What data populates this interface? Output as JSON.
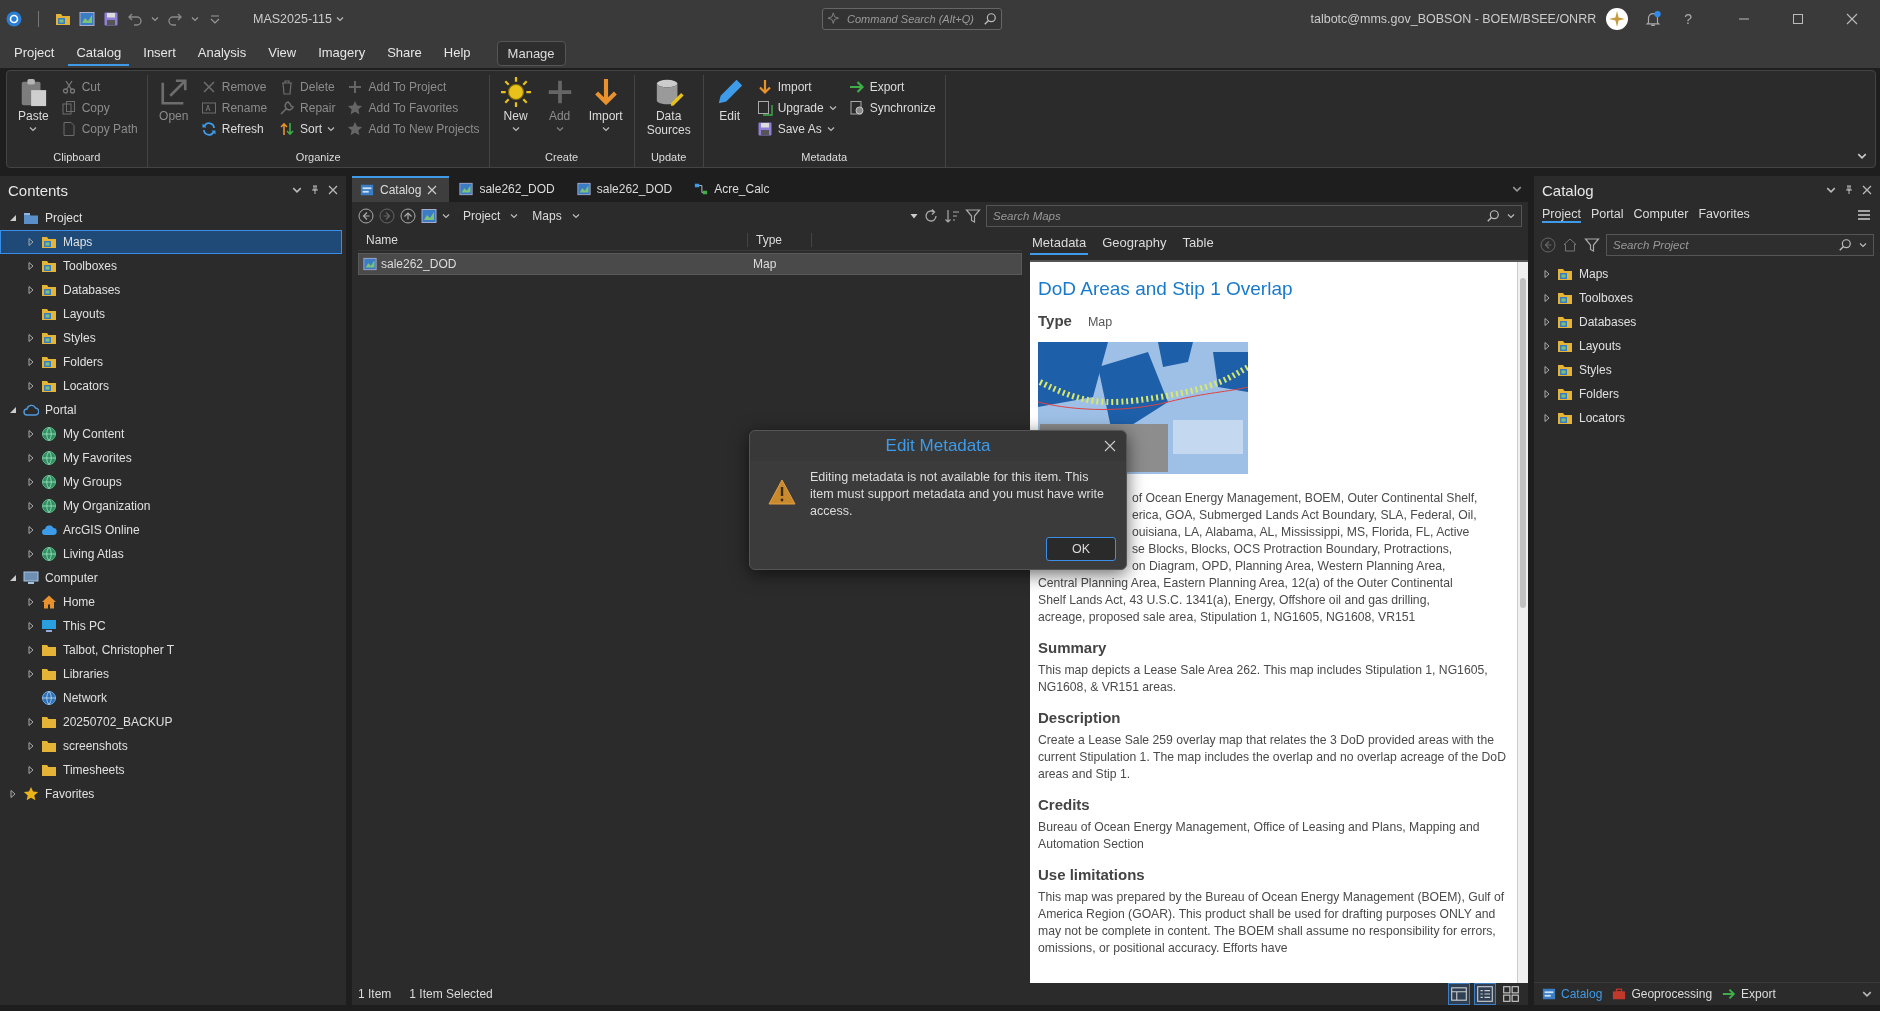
{
  "title_bar": {
    "project_name": "MAS2025-115",
    "command_search": {
      "placeholder": "Command Search (Alt+Q)"
    },
    "user": "talbotc@mms.gov_BOBSON - BOEM/BSEE/ONRR",
    "has_notification": true,
    "help": "?"
  },
  "menu_tabs": [
    {
      "label": "Project",
      "selected": false
    },
    {
      "label": "Catalog",
      "selected": true
    },
    {
      "label": "Insert",
      "selected": false
    },
    {
      "label": "Analysis",
      "selected": false
    },
    {
      "label": "View",
      "selected": false
    },
    {
      "label": "Imagery",
      "selected": false
    },
    {
      "label": "Share",
      "selected": false
    },
    {
      "label": "Help",
      "selected": false
    }
  ],
  "context_tab": "Manage",
  "ribbon": {
    "groups": [
      {
        "label": "Clipboard",
        "items": [
          {
            "label": "Paste",
            "kind": "large",
            "disabled": false,
            "dropdown": true
          },
          {
            "label": "Cut",
            "kind": "small",
            "disabled": true,
            "dropdown": false
          },
          {
            "label": "Copy",
            "kind": "small",
            "disabled": true,
            "dropdown": false
          },
          {
            "label": "Copy Path",
            "kind": "small",
            "disabled": true,
            "dropdown": false
          }
        ]
      },
      {
        "label": "Organize",
        "items": [
          {
            "label": "Open",
            "kind": "large",
            "disabled": true,
            "dropdown": false
          },
          {
            "label": "Remove",
            "kind": "small",
            "disabled": true,
            "dropdown": false
          },
          {
            "label": "Rename",
            "kind": "small",
            "disabled": true,
            "dropdown": false
          },
          {
            "label": "Refresh",
            "kind": "small",
            "disabled": false,
            "dropdown": false
          },
          {
            "label": "Delete",
            "kind": "small",
            "disabled": true,
            "dropdown": false
          },
          {
            "label": "Repair",
            "kind": "small",
            "disabled": true,
            "dropdown": false
          },
          {
            "label": "Sort",
            "kind": "small",
            "disabled": false,
            "dropdown": true
          },
          {
            "label": "Add To Project",
            "kind": "small",
            "disabled": true,
            "dropdown": false
          },
          {
            "label": "Add To Favorites",
            "kind": "small",
            "disabled": true,
            "dropdown": false
          },
          {
            "label": "Add To New Projects",
            "kind": "small",
            "disabled": true,
            "dropdown": false
          }
        ]
      },
      {
        "label": "Create",
        "items": [
          {
            "label": "New",
            "kind": "large",
            "disabled": false,
            "dropdown": true
          },
          {
            "label": "Add",
            "kind": "large",
            "disabled": true,
            "dropdown": true
          },
          {
            "label": "Import",
            "kind": "large",
            "disabled": false,
            "dropdown": true
          }
        ]
      },
      {
        "label": "Update",
        "items": [
          {
            "label": "Data Sources",
            "kind": "large",
            "disabled": false,
            "dropdown": false
          }
        ]
      },
      {
        "label": "Metadata",
        "items": [
          {
            "label": "Edit",
            "kind": "large",
            "disabled": false,
            "dropdown": false
          },
          {
            "label": "Import",
            "kind": "small",
            "disabled": false,
            "dropdown": false
          },
          {
            "label": "Upgrade",
            "kind": "small",
            "disabled": false,
            "dropdown": true
          },
          {
            "label": "Save As",
            "kind": "small",
            "disabled": false,
            "dropdown": true
          },
          {
            "label": "Export",
            "kind": "small",
            "disabled": false,
            "dropdown": false
          },
          {
            "label": "Synchronize",
            "kind": "small",
            "disabled": false,
            "dropdown": false
          }
        ]
      }
    ]
  },
  "contents": {
    "title": "Contents",
    "tree": [
      {
        "label": "Project",
        "kind": "project",
        "expanded": true,
        "selected": false,
        "children": [
          {
            "label": "Maps",
            "kind": "catalog-folder",
            "expanded": false,
            "selected": true
          },
          {
            "label": "Toolboxes",
            "kind": "catalog-folder",
            "expanded": false,
            "selected": false
          },
          {
            "label": "Databases",
            "kind": "catalog-folder",
            "expanded": false,
            "selected": false
          },
          {
            "label": "Layouts",
            "kind": "catalog-folder",
            "selected": false
          },
          {
            "label": "Styles",
            "kind": "catalog-folder",
            "expanded": false,
            "selected": false
          },
          {
            "label": "Folders",
            "kind": "catalog-folder",
            "expanded": false,
            "selected": false
          },
          {
            "label": "Locators",
            "kind": "catalog-folder",
            "expanded": false,
            "selected": false
          }
        ]
      },
      {
        "label": "Portal",
        "kind": "portal",
        "expanded": true,
        "selected": false,
        "children": [
          {
            "label": "My Content",
            "kind": "portal-item",
            "expanded": false,
            "selected": false
          },
          {
            "label": "My Favorites",
            "kind": "portal-item",
            "expanded": false,
            "selected": false
          },
          {
            "label": "My Groups",
            "kind": "portal-item",
            "expanded": false,
            "selected": false
          },
          {
            "label": "My Organization",
            "kind": "portal-item",
            "expanded": false,
            "selected": false
          },
          {
            "label": "ArcGIS Online",
            "kind": "cloud",
            "expanded": false,
            "selected": false
          },
          {
            "label": "Living Atlas",
            "kind": "portal-item",
            "expanded": false,
            "selected": false
          }
        ]
      },
      {
        "label": "Computer",
        "kind": "computer",
        "expanded": true,
        "selected": false,
        "children": [
          {
            "label": "Home",
            "kind": "home",
            "expanded": false,
            "selected": false
          },
          {
            "label": "This PC",
            "kind": "pc",
            "expanded": false,
            "selected": false
          },
          {
            "label": "Talbot, Christopher T",
            "kind": "folder",
            "expanded": false,
            "selected": false
          },
          {
            "label": "Libraries",
            "kind": "folder",
            "expanded": false,
            "selected": false
          },
          {
            "label": "Network",
            "kind": "network",
            "selected": false
          },
          {
            "label": "20250702_BACKUP",
            "kind": "folder",
            "expanded": false,
            "selected": false
          },
          {
            "label": "screenshots",
            "kind": "folder",
            "expanded": false,
            "selected": false
          },
          {
            "label": "Timesheets",
            "kind": "folder",
            "expanded": false,
            "selected": false
          }
        ]
      },
      {
        "label": "Favorites",
        "kind": "favorites",
        "expanded": false,
        "selected": false
      }
    ]
  },
  "doc_tabs": [
    {
      "label": "Catalog",
      "kind": "catalog",
      "selected": true
    },
    {
      "label": "sale262_DOD",
      "kind": "map",
      "selected": false
    },
    {
      "label": "sale262_DOD",
      "kind": "map",
      "selected": false
    },
    {
      "label": "Acre_Calc",
      "kind": "model",
      "selected": false
    }
  ],
  "browser": {
    "breadcrumb": [
      "Project",
      "Maps"
    ],
    "search": {
      "placeholder": "Search Maps"
    },
    "columns": [
      "Name",
      "Type"
    ],
    "rows": [
      {
        "cells": [
          "sale262_DOD",
          "Map"
        ],
        "selected": true
      }
    ]
  },
  "metadata": {
    "tabs": [
      {
        "label": "Metadata",
        "selected": true
      },
      {
        "label": "Geography",
        "selected": false
      },
      {
        "label": "Table",
        "selected": false
      }
    ],
    "title": "DoD Areas and Stip 1 Overlap",
    "type_label": "Type",
    "type_value": "Map",
    "tag_lines": [
      {
        "text": "of Ocean Energy Management, BOEM, Outer Continental Shelf,",
        "covered": true
      },
      {
        "text": "erica, GOA, Submerged Lands Act Boundary, SLA, Federal, Oil,",
        "covered": true
      },
      {
        "text": "ouisiana, LA, Alabama, AL, Mississippi, MS, Florida, FL, Active",
        "covered": true
      },
      {
        "text": "se Blocks, Blocks, OCS Protraction Boundary, Protractions,",
        "covered": true
      },
      {
        "text": "on Diagram, OPD, Planning Area, Western Planning Area,",
        "covered": true
      },
      {
        "text": "Central Planning Area, Eastern Planning Area, 12(a) of the Outer Continental",
        "covered": false
      },
      {
        "text": "Shelf Lands Act, 43 U.S.C. 1341(a), Energy, Offshore oil and gas drilling,",
        "covered": false
      },
      {
        "text": "acreage, proposed sale area, Stipulation 1, NG1605, NG1608, VR151",
        "covered": false
      }
    ],
    "sections": [
      {
        "heading": "Summary",
        "body": "This map depicts a Lease Sale Area 262. This map includes Stipulation 1, NG1605, NG1608, & VR151 areas."
      },
      {
        "heading": "Description",
        "body": "Create a Lease Sale 259 overlay map that relates the 3 DoD provided areas with the current Stipulation 1. The map includes the overlap and no overlap acreage of the DoD areas and Stip 1."
      },
      {
        "heading": "Credits",
        "body": "Bureau of Ocean Energy Management, Office of Leasing and Plans, Mapping and Automation Section"
      },
      {
        "heading": "Use limitations",
        "body": "This map was prepared by the Bureau of Ocean Energy Management (BOEM), Gulf of America Region (GOAR). This product shall be used for drafting purposes ONLY and may not be complete in content. The BOEM shall assume no responsibility for errors, omissions, or positional accuracy. Efforts have"
      }
    ]
  },
  "status_bar": [
    "1 Item",
    "1 Item Selected"
  ],
  "catalog": {
    "title": "Catalog",
    "tabs": [
      {
        "label": "Project",
        "selected": true
      },
      {
        "label": "Portal",
        "selected": false
      },
      {
        "label": "Computer",
        "selected": false
      },
      {
        "label": "Favorites",
        "selected": false
      }
    ],
    "search": {
      "placeholder": "Search Project"
    },
    "items": [
      {
        "label": "Maps"
      },
      {
        "label": "Toolboxes"
      },
      {
        "label": "Databases"
      },
      {
        "label": "Layouts"
      },
      {
        "label": "Styles"
      },
      {
        "label": "Folders"
      },
      {
        "label": "Locators"
      }
    ],
    "bottom_tabs": [
      {
        "label": "Catalog",
        "kind": "catalog",
        "selected": true
      },
      {
        "label": "Geoprocessing",
        "kind": "toolbox",
        "selected": false
      },
      {
        "label": "Export",
        "kind": "export",
        "selected": false
      }
    ]
  },
  "dialog": {
    "title": "Edit Metadata",
    "message": "Editing metadata is not available for this item. This item must support metadata and you must have write access.",
    "ok": "OK"
  }
}
